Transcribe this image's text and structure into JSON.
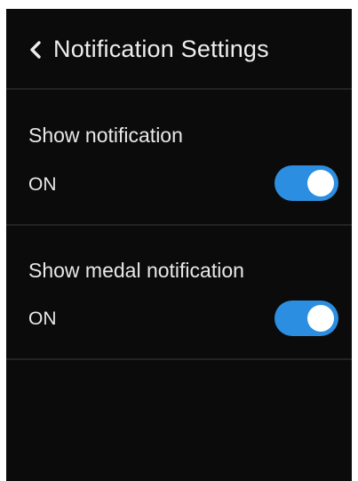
{
  "header": {
    "back_icon": "chevron-left-icon",
    "title": "Notification Settings"
  },
  "settings": [
    {
      "title": "Show notification",
      "value": "ON",
      "enabled": true
    },
    {
      "title": "Show medal notification",
      "value": "ON",
      "enabled": true
    }
  ],
  "colors": {
    "background": "#0b0b0b",
    "text": "#ececec",
    "divider": "#232323",
    "toggle_on": "#2b8ee0",
    "knob": "#ffffff"
  }
}
